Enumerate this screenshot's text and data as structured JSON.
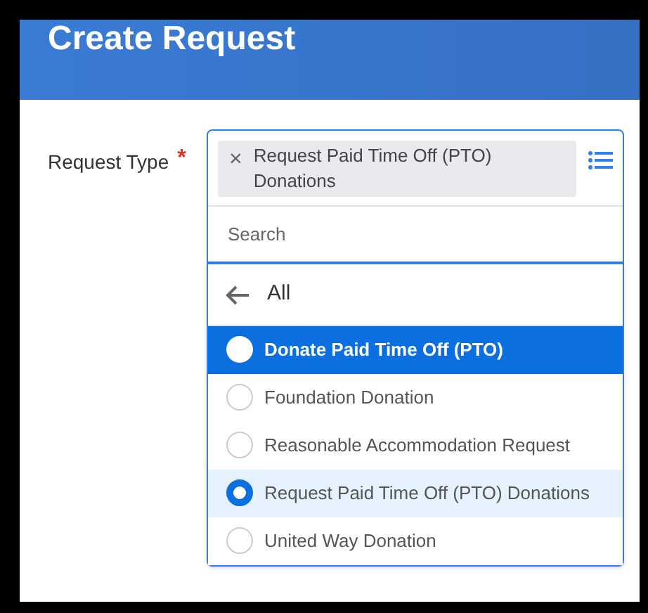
{
  "header": {
    "title": "Create Request"
  },
  "field": {
    "label": "Request Type",
    "required_mark": "*",
    "chip": {
      "remove": "×",
      "text": "Request Paid Time Off (PTO) Donations"
    },
    "search": {
      "placeholder": "Search"
    }
  },
  "dropdown": {
    "back_label": "All",
    "options": [
      {
        "label": "Donate Paid Time Off (PTO)",
        "selected": false,
        "highlighted": true
      },
      {
        "label": "Foundation Donation",
        "selected": false,
        "highlighted": false
      },
      {
        "label": "Reasonable Accommodation Request",
        "selected": false,
        "highlighted": false
      },
      {
        "label": "Request Paid Time Off (PTO) Donations",
        "selected": true,
        "highlighted": false
      },
      {
        "label": "United Way Donation",
        "selected": false,
        "highlighted": false
      }
    ]
  }
}
